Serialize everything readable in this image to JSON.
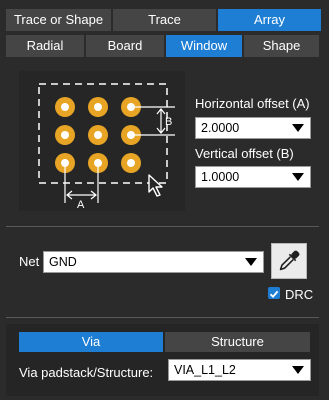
{
  "modes": [
    {
      "label": "Trace or Shape",
      "active": false
    },
    {
      "label": "Trace",
      "active": false
    },
    {
      "label": "Array",
      "active": true
    }
  ],
  "array_types": [
    {
      "label": "Radial",
      "active": false
    },
    {
      "label": "Board",
      "active": false
    },
    {
      "label": "Window",
      "active": true
    },
    {
      "label": "Shape",
      "active": false
    }
  ],
  "diagram": {
    "label_a": "A",
    "label_b": "B",
    "pad_color": "#e8a424",
    "dimension_color": "#ffffff"
  },
  "offsets": {
    "horizontal_label": "Horizontal offset (A)",
    "horizontal_value": "2.0000",
    "vertical_label": "Vertical offset (B)",
    "vertical_value": "1.0000"
  },
  "net": {
    "label": "Net",
    "value": "GND",
    "picker_icon": "eyedropper-icon",
    "drc_label": "DRC",
    "drc_checked": true
  },
  "bottom_tabs": [
    {
      "label": "Via",
      "active": true
    },
    {
      "label": "Structure",
      "active": false
    }
  ],
  "via": {
    "label": "Via padstack/Structure:",
    "value": "VIA_L1_L2"
  },
  "colors": {
    "background": "#2b2b2b",
    "button": "#454545",
    "accent": "#1e7ed4"
  }
}
